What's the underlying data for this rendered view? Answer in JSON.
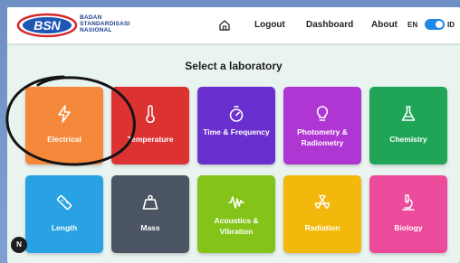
{
  "header": {
    "logo_text": "BSN",
    "org_name_lines": [
      "BADAN",
      "STANDARDISASI",
      "NASIONAL"
    ],
    "nav": {
      "logout": "Logout",
      "dashboard": "Dashboard",
      "about": "About"
    },
    "language": {
      "left": "EN",
      "right": "ID",
      "selected": "ID"
    }
  },
  "main": {
    "title": "Select a laboratory",
    "labs": [
      {
        "label": "Electrical",
        "color": "#f5883a",
        "icon": "lightning-icon"
      },
      {
        "label": "Temperature",
        "color": "#dc3232",
        "icon": "thermometer-icon"
      },
      {
        "label": "Time & Frequency",
        "color": "#6a2fcf",
        "icon": "stopwatch-icon"
      },
      {
        "label": "Photometry & Radiometry",
        "color": "#b036d4",
        "icon": "lightbulb-icon"
      },
      {
        "label": "Chemistry",
        "color": "#20a558",
        "icon": "flask-icon"
      },
      {
        "label": "Length",
        "color": "#28a2e2",
        "icon": "ruler-icon"
      },
      {
        "label": "Mass",
        "color": "#4b5563",
        "icon": "weight-icon"
      },
      {
        "label": "Acoustics & Vibration",
        "color": "#84c419",
        "icon": "soundwave-icon"
      },
      {
        "label": "Radiation",
        "color": "#f2b80c",
        "icon": "radiation-icon"
      },
      {
        "label": "Biology",
        "color": "#ec4a9a",
        "icon": "microscope-icon"
      }
    ]
  },
  "badge": {
    "letter": "N"
  }
}
